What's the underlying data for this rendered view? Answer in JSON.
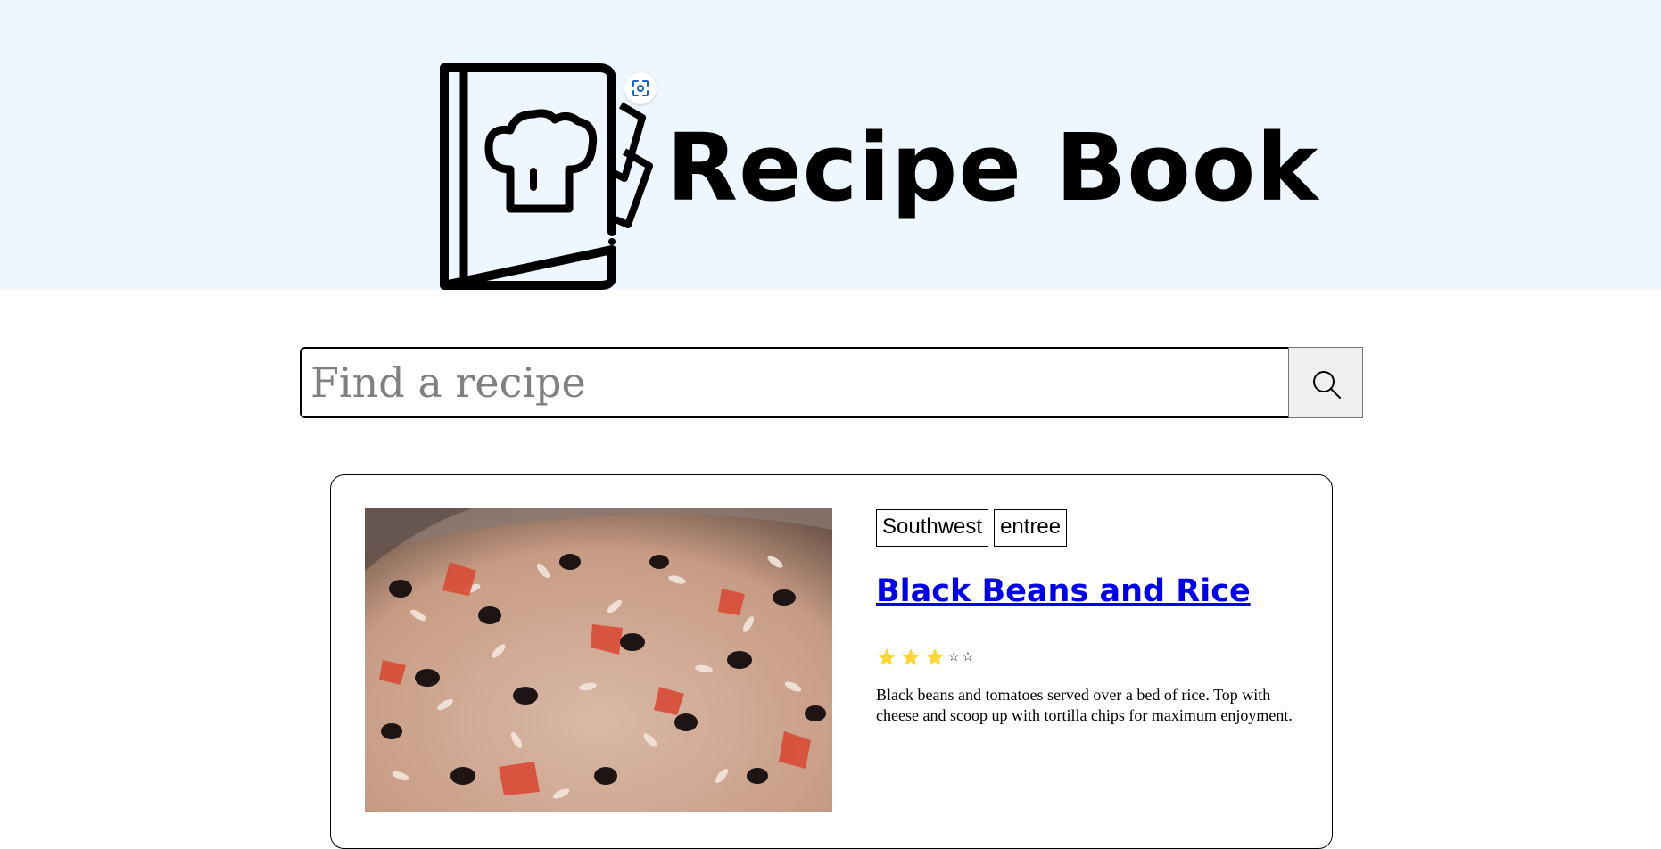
{
  "header": {
    "title": "Recipe Book",
    "logo_icon": "recipe-book-chef-hat-icon",
    "background": "#eef6ff"
  },
  "search": {
    "placeholder": "Find a recipe",
    "value": "",
    "button_icon": "search-icon"
  },
  "recipes": [
    {
      "tags": [
        "Southwest",
        "entree"
      ],
      "title": "Black Beans and Rice",
      "rating": 3,
      "rating_max": 5,
      "description": "Black beans and tomatoes served over a bed of rice. Top with cheese and scoop up with tortilla chips for maximum enjoyment.",
      "image_icon": "black-beans-and-rice-photo"
    }
  ],
  "colors": {
    "link": "#0000ee",
    "star": "#fdd835"
  }
}
